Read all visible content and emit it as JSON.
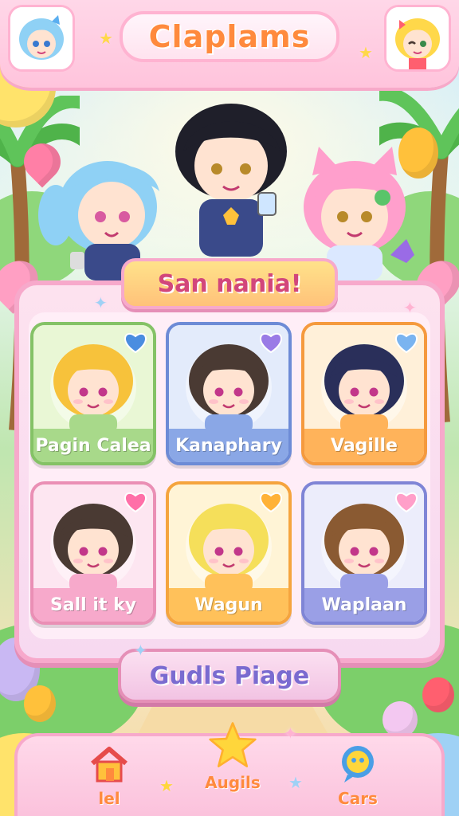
{
  "app": {
    "title": "Claplams"
  },
  "hero": {
    "banner_text": "San nania!"
  },
  "characters": [
    {
      "name": "Pagin Calea",
      "card_color": "#a8d98a",
      "border_color": "#84c266",
      "hair_color": "#f7c23b",
      "bg_color": "#e9f7d5",
      "heart_color": "#4a8de0"
    },
    {
      "name": "Kanaphary",
      "card_color": "#8aa7e6",
      "border_color": "#6d8bd6",
      "hair_color": "#4a3a33",
      "bg_color": "#e3ebfb",
      "heart_color": "#9a7be6"
    },
    {
      "name": "Vagille",
      "card_color": "#ffb35a",
      "border_color": "#f59a3e",
      "hair_color": "#2a2f5a",
      "bg_color": "#fff0d9",
      "heart_color": "#7ab4f0"
    },
    {
      "name": "Sall it ky",
      "card_color": "#f7a9cb",
      "border_color": "#ea8fb5",
      "hair_color": "#4a3a33",
      "bg_color": "#fde6f1",
      "heart_color": "#ff6fa8"
    },
    {
      "name": "Wagun",
      "card_color": "#ffc15a",
      "border_color": "#f5a43e",
      "hair_color": "#f5df5a",
      "bg_color": "#fff4d6",
      "heart_color": "#ffb238"
    },
    {
      "name": "Waplaan",
      "card_color": "#9a9fe6",
      "border_color": "#7f85d6",
      "hair_color": "#8a5a32",
      "bg_color": "#ecedfb",
      "heart_color": "#ff9fc9"
    }
  ],
  "page_button": {
    "label": "Gudls Piage"
  },
  "nav": [
    {
      "label": "lel",
      "icon": "house-icon"
    },
    {
      "label": "Augils",
      "icon": "star-icon"
    },
    {
      "label": "Cars",
      "icon": "chat-icon"
    }
  ],
  "colors": {
    "accent": "#ff8a3d",
    "pink_frame": "#f7a9cb",
    "title_text": "#ff8a3d"
  }
}
